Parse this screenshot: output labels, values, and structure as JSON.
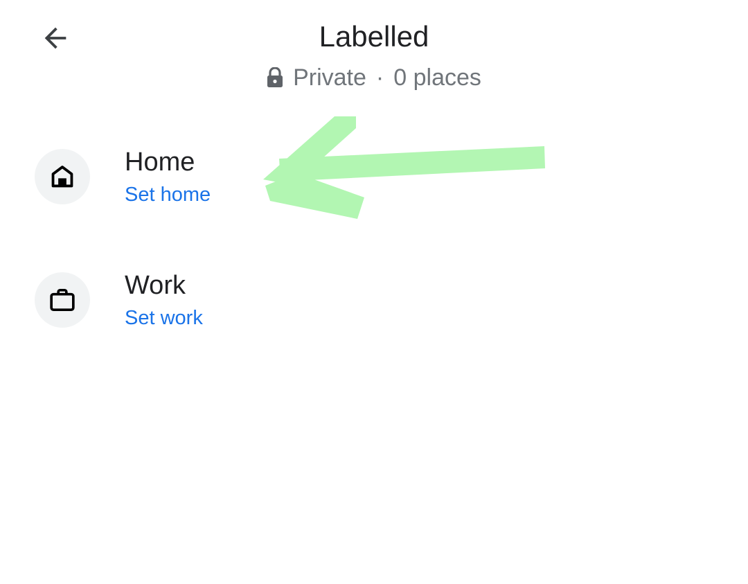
{
  "header": {
    "back_icon": "arrow-back-icon",
    "title": "Labelled",
    "lock_icon": "lock-icon",
    "privacy": "Private",
    "separator": "·",
    "count": "0 places"
  },
  "items": [
    {
      "icon": "home-icon",
      "title": "Home",
      "action": "Set home"
    },
    {
      "icon": "briefcase-icon",
      "title": "Work",
      "action": "Set work"
    }
  ],
  "colors": {
    "link": "#1a73e8",
    "icon_bg": "#f1f3f4",
    "annotation_arrow": "#7cf07c"
  }
}
